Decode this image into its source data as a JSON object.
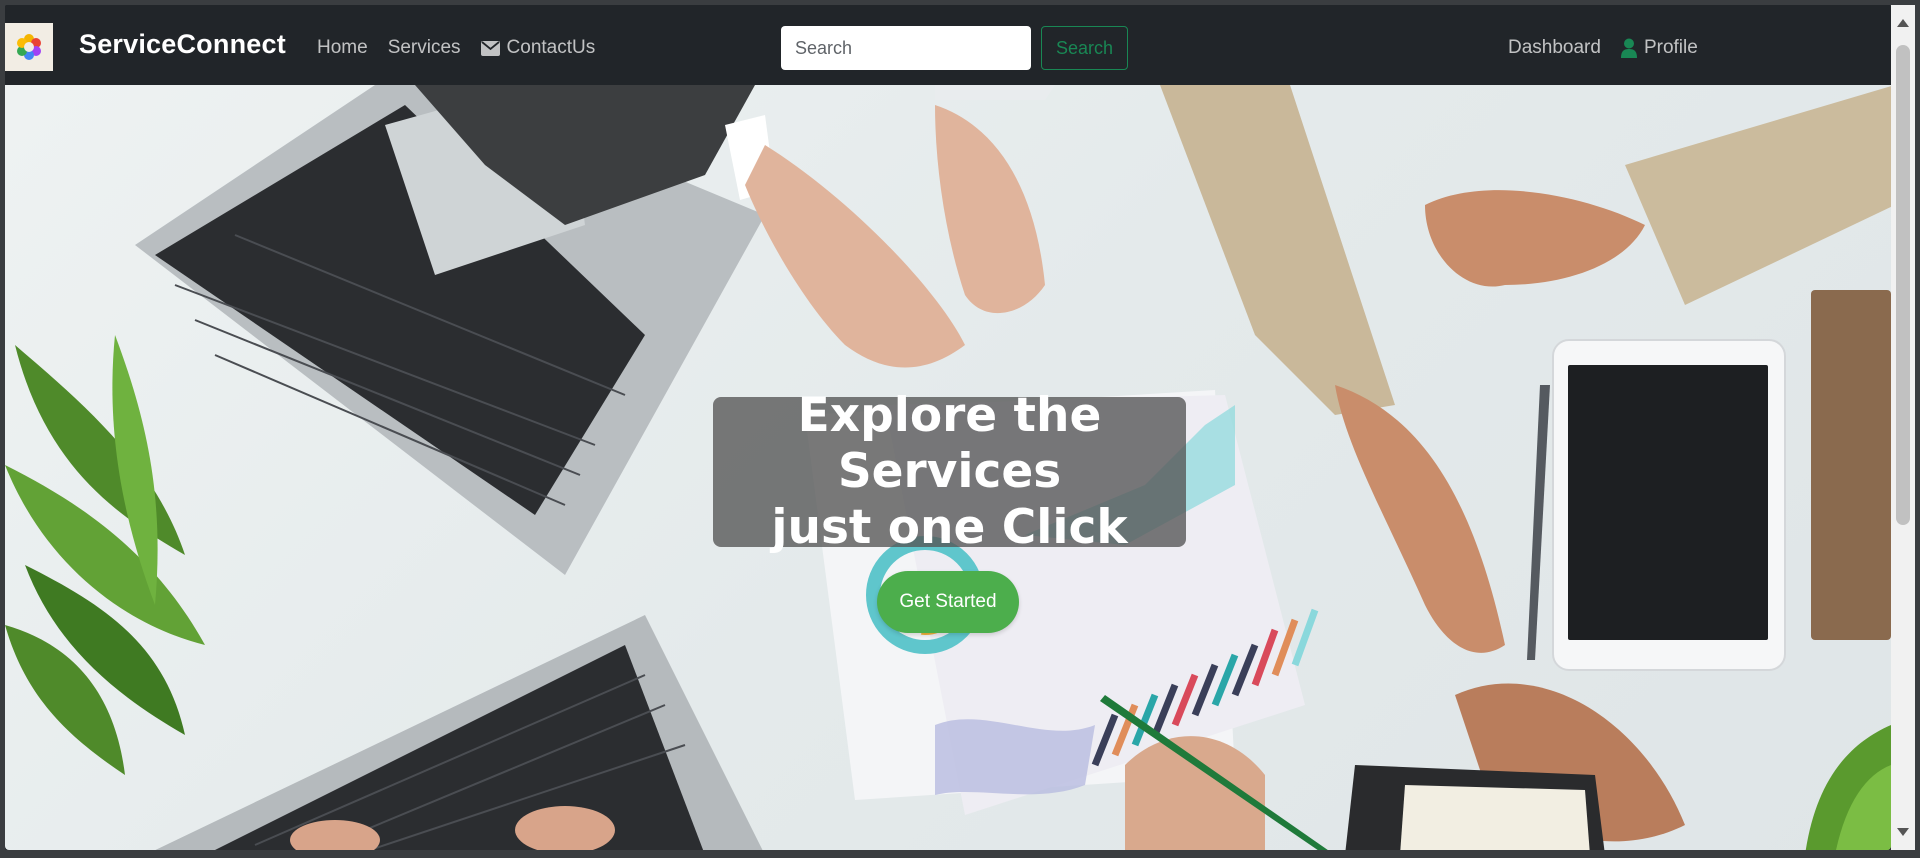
{
  "navbar": {
    "brand": "ServiceConnect",
    "links": [
      {
        "label": "Home",
        "icon": "none"
      },
      {
        "label": "Services",
        "icon": "none"
      },
      {
        "label": "ContactUs",
        "icon": "envelope-icon"
      }
    ],
    "search": {
      "placeholder": "Search",
      "button_label": "Search"
    },
    "right_links": [
      {
        "label": "Dashboard",
        "icon": "none"
      },
      {
        "label": "Profile",
        "icon": "user-icon"
      }
    ]
  },
  "hero": {
    "title_line1": "Explore the Services",
    "title_line2": "just one Click",
    "cta_label": "Get Started"
  },
  "colors": {
    "navbar_bg": "#212529",
    "accent_green": "#198754",
    "cta_green": "#4cae4c",
    "card_overlay": "rgba(85,85,85,0.78)"
  }
}
